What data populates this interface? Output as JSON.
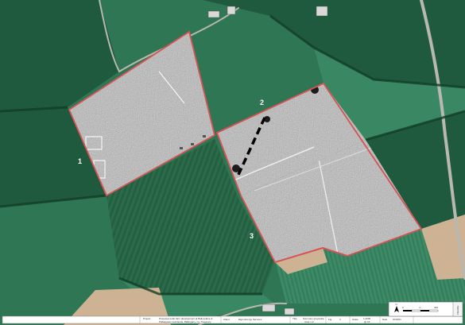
{
  "map": {
    "area_labels": [
      "1",
      "2",
      "3"
    ],
    "colors": {
      "field_dark": "#1f5a3f",
      "field_mid": "#2f7654",
      "field_light": "#3a8763",
      "field_bright": "#5ba582",
      "plough_tan": "#cdb393",
      "survey_grey": "#b9b9b9",
      "boundary_red": "#d65454",
      "road": "#b8b8b0"
    },
    "survey_areas": [
      {
        "label": "1"
      },
      {
        "label": "2"
      },
      {
        "label": "3"
      }
    ]
  },
  "north_arrow": {
    "letter": "N"
  },
  "scale_bar": {
    "ticks": [
      "0",
      "m",
      "400"
    ]
  },
  "side_tab": "FIGURE",
  "title_block": {
    "project_label": "Project",
    "project_line_1": "Proposed solar farm development at Ballyvolane &",
    "project_line_2": "Pallasgreen townlands, Ballingarry, Co. Tipperary",
    "client_label": "Client",
    "client": "Elgin Energy Services",
    "title_label": "Title",
    "title": "Summary greyscale",
    "subtitle": "Area 1-3",
    "fig_label": "Fig.",
    "fig_value": "4",
    "scale_label": "Scale",
    "scale_value": "1:4000",
    "scale_sub": "@ A3",
    "date_label": "Date",
    "date_value": "2016/01"
  }
}
